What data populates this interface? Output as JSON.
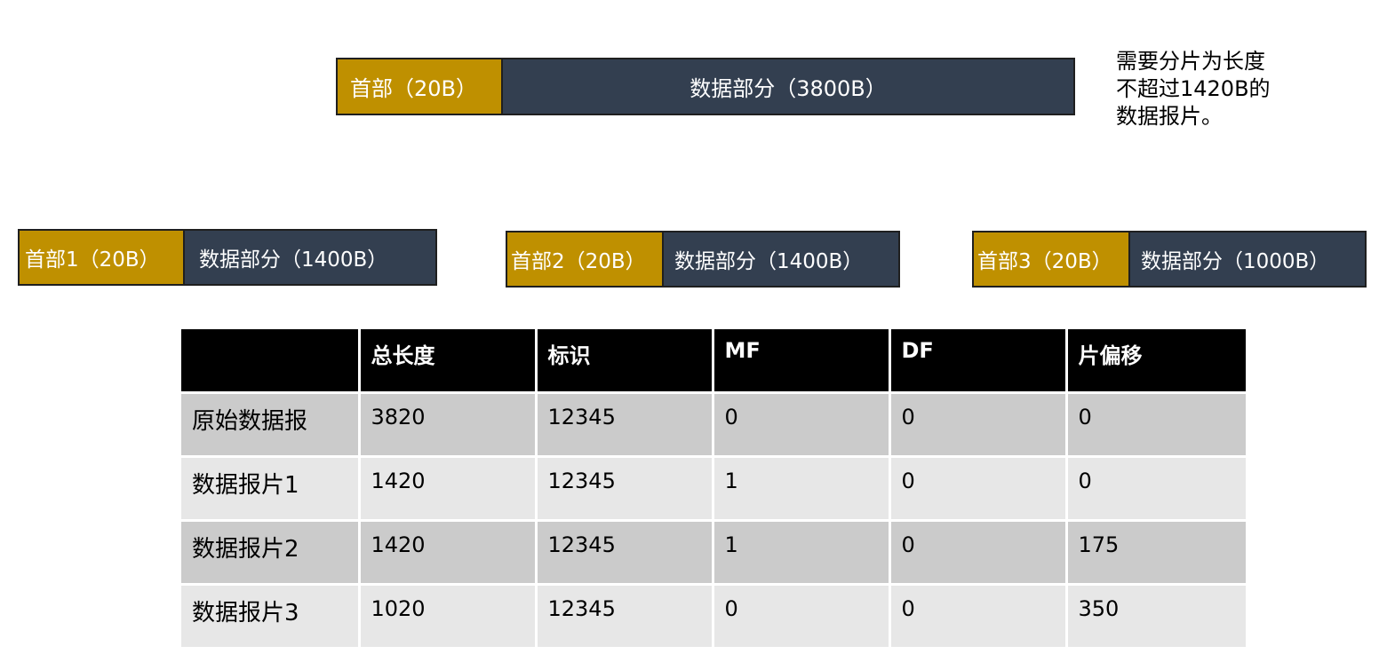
{
  "original": {
    "header_label": "首部（20B）",
    "data_label": "数据部分（3800B）"
  },
  "note": {
    "line1": "需要分片为长度",
    "line2": "不超过1420B的",
    "line3": "数据报片。"
  },
  "fragments": [
    {
      "header_label": "首部1（20B）",
      "data_label": "数据部分（1400B）"
    },
    {
      "header_label": "首部2（20B）",
      "data_label": "数据部分（1400B）"
    },
    {
      "header_label": "首部3（20B）",
      "data_label": "数据部分（1000B）"
    }
  ],
  "table": {
    "columns": [
      "",
      "总长度",
      "标识",
      "MF",
      "DF",
      "片偏移"
    ],
    "rows": [
      [
        "原始数据报",
        "3820",
        "12345",
        "0",
        "0",
        "0"
      ],
      [
        "数据报片1",
        "1420",
        "12345",
        "1",
        "0",
        "0"
      ],
      [
        "数据报片2",
        "1420",
        "12345",
        "1",
        "0",
        "175"
      ],
      [
        "数据报片3",
        "1020",
        "12345",
        "0",
        "0",
        "350"
      ]
    ]
  },
  "colors": {
    "header": "#bf9000",
    "data": "#333f50",
    "table_header_bg": "#000000",
    "row_odd": "#cbcbcb",
    "row_even": "#e7e7e7"
  }
}
